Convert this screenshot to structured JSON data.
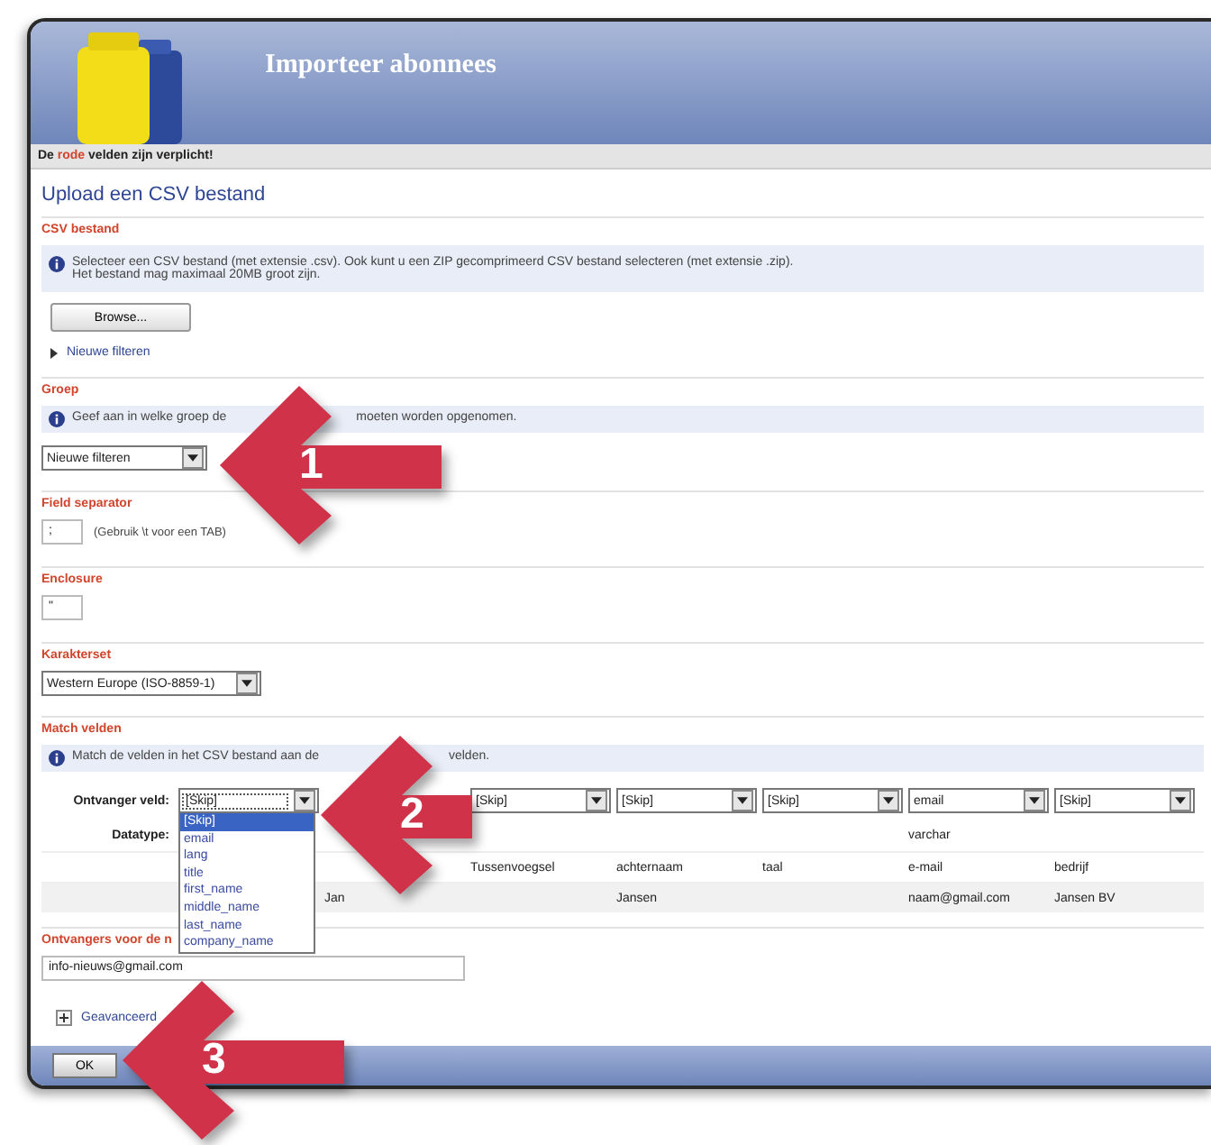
{
  "window": {
    "title": "Importeer abonnees"
  },
  "notice": [
    {
      "text": "De",
      "kind": "plain"
    },
    {
      "text": "rode",
      "kind": "highlight"
    },
    {
      "text": "velden zijn verplicht!",
      "kind": "plain"
    }
  ],
  "heading": "Upload een CSV bestand",
  "sections": [
    {
      "kind": "file",
      "legend": "CSV bestand",
      "info": [
        "Selecteer een CSV bestand (met extensie .csv). Ook kunt u een ZIP gecomprimeerd CSV bestand selecteren (met extensie .zip).",
        "Het bestand mag maximaal 20MB groot zijn."
      ],
      "button": "Browse...",
      "link": "Nieuwe filteren"
    },
    {
      "kind": "select",
      "legend": "Groep",
      "info": [
        "Geef aan in welke groep de",
        "moeten worden opgenomen."
      ],
      "value": "Nieuwe filteren"
    },
    {
      "kind": "input",
      "legend": "Field separator",
      "value": ";",
      "hint": "(Gebruik \\t voor een TAB)"
    },
    {
      "kind": "input",
      "legend": "Enclosure",
      "value": "\""
    },
    {
      "kind": "select",
      "legend": "Karakterset",
      "value": "Western Europe (ISO-8859-1)"
    },
    {
      "kind": "match",
      "legend": "Match velden",
      "info": [
        "Match de velden in het CSV bestand aan de",
        "velden."
      ],
      "row_label": "Ontvanger veld:",
      "type_label": "Datatype:",
      "selects": [
        {
          "value": "[Skip]",
          "open": true,
          "options": [
            {
              "label": "[Skip]",
              "selected": true
            },
            {
              "label": "email",
              "selected": false
            },
            {
              "label": "lang",
              "selected": false
            },
            {
              "label": "title",
              "selected": false
            },
            {
              "label": "first_name",
              "selected": false
            },
            {
              "label": "middle_name",
              "selected": false
            },
            {
              "label": "last_name",
              "selected": false
            },
            {
              "label": "company_name",
              "selected": false
            }
          ]
        },
        {
          "kind": "covered"
        },
        {
          "value": "[Skip]",
          "open": false
        },
        {
          "value": "[Skip]",
          "open": false
        },
        {
          "value": "[Skip]",
          "open": false
        },
        {
          "value": "email",
          "open": false
        },
        {
          "value": "[Skip]",
          "open": false
        }
      ],
      "types": [
        {
          "kind": "empty"
        },
        {
          "kind": "empty"
        },
        {
          "kind": "empty"
        },
        {
          "kind": "empty"
        },
        {
          "kind": "empty"
        },
        {
          "kind": "text",
          "text": "varchar"
        },
        {
          "kind": "empty"
        }
      ],
      "rows": [
        [
          {
            "kind": "empty"
          },
          {
            "kind": "empty"
          },
          {
            "kind": "text",
            "text": "Tussenvoegsel"
          },
          {
            "kind": "text",
            "text": "achternaam"
          },
          {
            "kind": "text",
            "text": "taal"
          },
          {
            "kind": "text",
            "text": "e-mail"
          },
          {
            "kind": "text",
            "text": "bedrijf"
          }
        ],
        [
          {
            "kind": "empty"
          },
          {
            "kind": "text",
            "text": "Jan"
          },
          {
            "kind": "empty"
          },
          {
            "kind": "text",
            "text": "Jansen"
          },
          {
            "kind": "empty"
          },
          {
            "kind": "text",
            "text": "naam@gmail.com"
          },
          {
            "kind": "text",
            "text": "Jansen BV"
          }
        ]
      ]
    },
    {
      "kind": "input",
      "legend": "Ontvangers voor de n",
      "value": "info-nieuws@gmail.com",
      "wide": true
    }
  ],
  "advanced": "Geavanceerd",
  "footer": {
    "button": "OK"
  },
  "arrows": [
    {
      "label": "1"
    },
    {
      "label": "2"
    },
    {
      "label": "3"
    }
  ]
}
